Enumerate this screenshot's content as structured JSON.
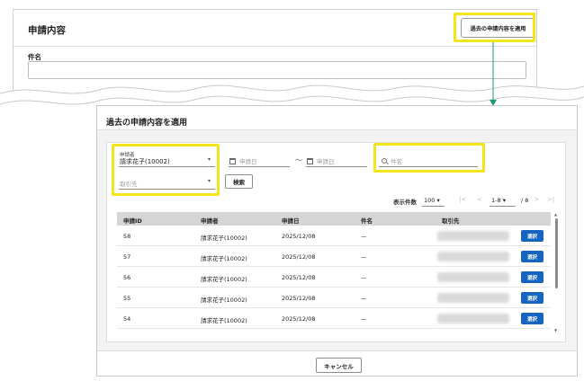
{
  "background_form": {
    "title": "申請内容",
    "apply_button": "過去の申請内容を適用",
    "subject_label": "件名"
  },
  "dialog": {
    "title": "過去の申請内容を適用",
    "filters": {
      "applicant_label": "申請者",
      "applicant_value": "請求花子(10002)",
      "date_from_placeholder": "申請日",
      "date_separator": "〜",
      "date_to_placeholder": "申請日",
      "keyword_placeholder": "件名",
      "client_placeholder": "取引先",
      "search_button": "検索"
    },
    "pager": {
      "label": "表示件数",
      "page_size": "100",
      "range": "1-8",
      "total": "/ 8"
    },
    "table": {
      "headers": [
        "申請ID",
        "申請者",
        "申請日",
        "件名",
        "取引先"
      ],
      "rows": [
        {
          "id": "58",
          "applicant": "請求花子(10002)",
          "date": "2025/12/08",
          "subject": "—",
          "action": "選択"
        },
        {
          "id": "57",
          "applicant": "請求花子(10002)",
          "date": "2025/12/08",
          "subject": "—",
          "action": "選択"
        },
        {
          "id": "56",
          "applicant": "請求花子(10002)",
          "date": "2025/12/08",
          "subject": "—",
          "action": "選択"
        },
        {
          "id": "55",
          "applicant": "請求花子(10002)",
          "date": "2025/12/08",
          "subject": "—",
          "action": "選択"
        },
        {
          "id": "54",
          "applicant": "請求花子(10002)",
          "date": "2025/12/08",
          "subject": "—",
          "action": "選択"
        }
      ]
    },
    "cancel_button": "キャンセル"
  },
  "colors": {
    "highlight": "#f2e51a",
    "primary": "#1565c0",
    "arrow": "#1e9e6a"
  },
  "icons": [
    "calendar-icon",
    "search-icon",
    "chevron-down-icon",
    "first-page-icon",
    "prev-page-icon",
    "next-page-icon",
    "last-page-icon"
  ]
}
